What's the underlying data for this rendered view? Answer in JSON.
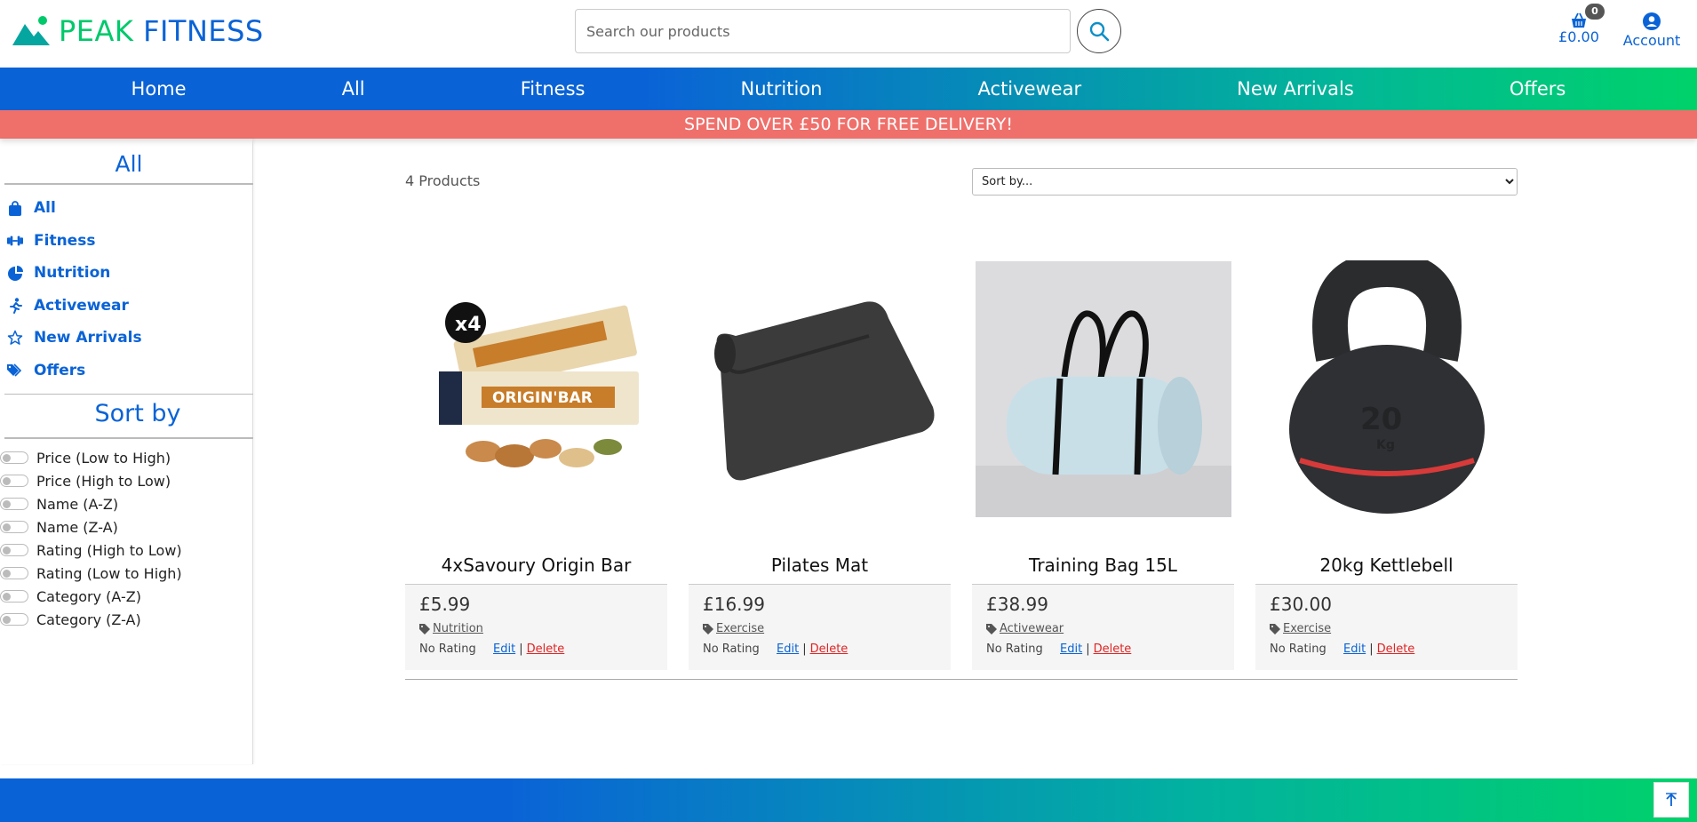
{
  "brand": {
    "name_part1": "PEAK",
    "name_part2": "FITNESS"
  },
  "search": {
    "placeholder": "Search our products"
  },
  "basket": {
    "count": "0",
    "total": "£0.00"
  },
  "account": {
    "label": "Account"
  },
  "nav": [
    "Home",
    "All",
    "Fitness",
    "Nutrition",
    "Activewear",
    "New Arrivals",
    "Offers"
  ],
  "promo": "SPEND OVER £50 FOR FREE DELIVERY!",
  "sidebar": {
    "title": "All",
    "categories": [
      {
        "label": "All",
        "icon": "shopping-bag-icon"
      },
      {
        "label": "Fitness",
        "icon": "dumbbell-icon"
      },
      {
        "label": "Nutrition",
        "icon": "pie-chart-icon"
      },
      {
        "label": "Activewear",
        "icon": "running-icon"
      },
      {
        "label": "New Arrivals",
        "icon": "star-icon"
      },
      {
        "label": "Offers",
        "icon": "tags-icon"
      }
    ],
    "sort_title": "Sort by",
    "sort_options": [
      "Price (Low to High)",
      "Price (High to Low)",
      "Name (A-Z)",
      "Name (Z-A)",
      "Rating (High to Low)",
      "Rating (Low to High)",
      "Category (A-Z)",
      "Category (Z-A)"
    ]
  },
  "main": {
    "count": "4 Products",
    "sort_select": "Sort by...",
    "edit_label": "Edit",
    "delete_label": "Delete",
    "products": [
      {
        "name": "4xSavoury Origin Bar",
        "price": "£5.99",
        "category": "Nutrition",
        "rating": "No Rating"
      },
      {
        "name": "Pilates Mat",
        "price": "£16.99",
        "category": "Exercise",
        "rating": "No Rating"
      },
      {
        "name": "Training Bag 15L",
        "price": "£38.99",
        "category": "Activewear",
        "rating": "No Rating"
      },
      {
        "name": "20kg Kettlebell",
        "price": "£30.00",
        "category": "Exercise",
        "rating": "No Rating"
      }
    ]
  },
  "colors": {
    "brand_blue": "#0a63d6",
    "brand_green": "#00c96b",
    "promo": "#ef706b",
    "delete": "#e02424"
  }
}
